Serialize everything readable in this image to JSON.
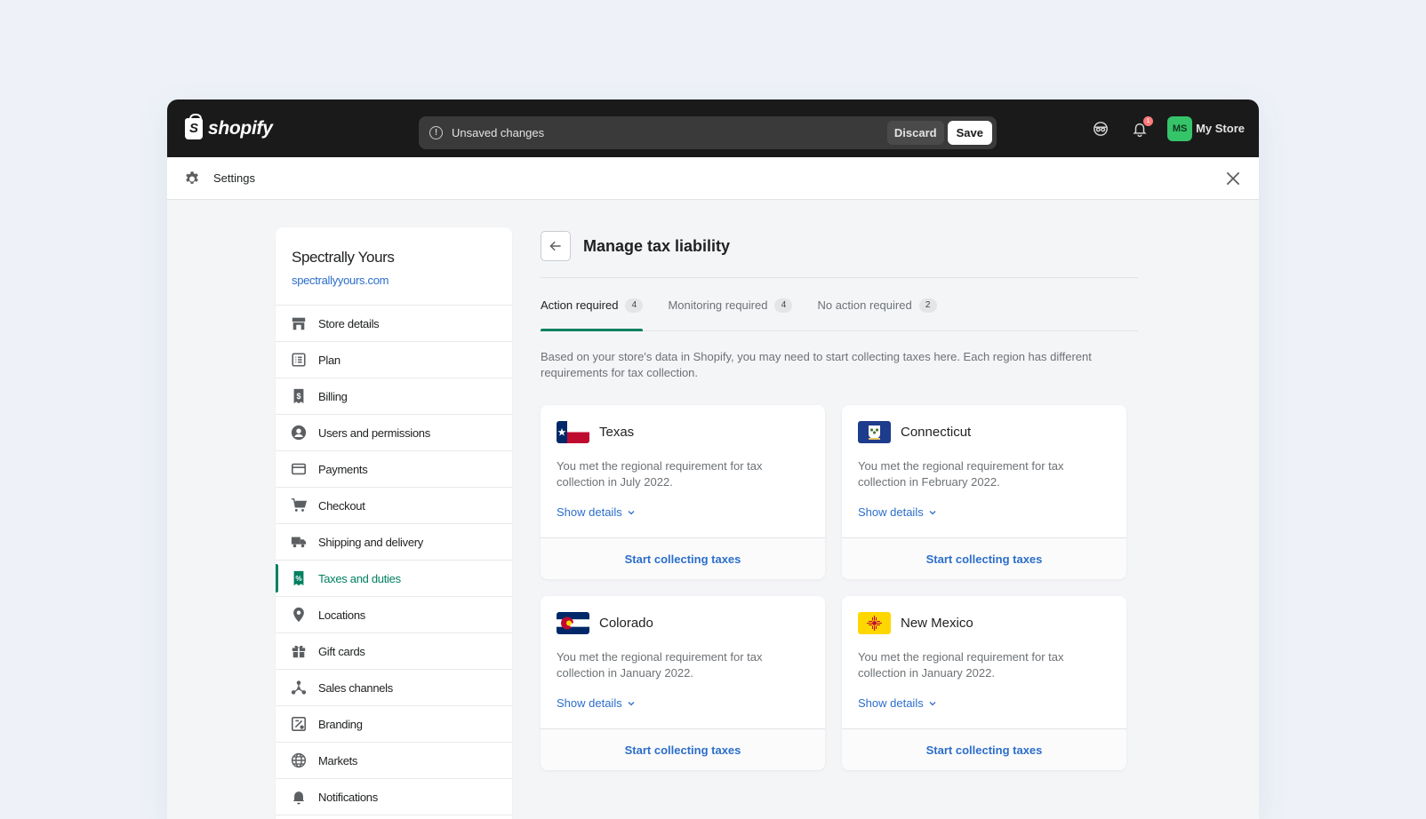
{
  "topbar": {
    "logo_text": "shopify",
    "unsaved_text": "Unsaved changes",
    "discard_label": "Discard",
    "save_label": "Save",
    "notification_count": "1",
    "avatar_initials": "MS",
    "store_name": "My Store"
  },
  "settings": {
    "title": "Settings"
  },
  "sidebar": {
    "store_title": "Spectrally Yours",
    "store_url": "spectrallyyours.com",
    "items": [
      {
        "label": "Store details",
        "icon": "store-icon"
      },
      {
        "label": "Plan",
        "icon": "plan-icon"
      },
      {
        "label": "Billing",
        "icon": "billing-icon"
      },
      {
        "label": "Users and permissions",
        "icon": "user-icon"
      },
      {
        "label": "Payments",
        "icon": "payments-icon"
      },
      {
        "label": "Checkout",
        "icon": "cart-icon"
      },
      {
        "label": "Shipping and delivery",
        "icon": "truck-icon"
      },
      {
        "label": "Taxes and duties",
        "icon": "tax-icon",
        "active": true
      },
      {
        "label": "Locations",
        "icon": "location-pin-icon"
      },
      {
        "label": "Gift cards",
        "icon": "gift-icon"
      },
      {
        "label": "Sales channels",
        "icon": "channels-icon"
      },
      {
        "label": "Branding",
        "icon": "branding-icon"
      },
      {
        "label": "Markets",
        "icon": "globe-icon"
      },
      {
        "label": "Notifications",
        "icon": "bell-icon"
      }
    ]
  },
  "main": {
    "title": "Manage tax liability",
    "tabs": [
      {
        "label": "Action required",
        "count": "4",
        "active": true
      },
      {
        "label": "Monitoring required",
        "count": "4"
      },
      {
        "label": "No action required",
        "count": "2"
      }
    ],
    "intro": "Based on your store's data in Shopify, you may need to start collecting taxes here. Each region has different requirements for tax collection.",
    "cards": [
      {
        "region": "Texas",
        "text": "You met the regional requirement for tax collection in July 2022.",
        "details_label": "Show details",
        "action_label": "Start collecting taxes"
      },
      {
        "region": "Connecticut",
        "text": "You met the regional requirement for tax collection in February 2022.",
        "details_label": "Show details",
        "action_label": "Start collecting taxes"
      },
      {
        "region": "Colorado",
        "text": "You met the regional requirement for tax collection in January 2022.",
        "details_label": "Show details",
        "action_label": "Start collecting taxes"
      },
      {
        "region": "New Mexico",
        "text": "You met the regional requirement for tax collection in January 2022.",
        "details_label": "Show details",
        "action_label": "Start collecting taxes"
      }
    ]
  },
  "colors": {
    "accent_green": "#008060",
    "link_blue": "#2c6ecb",
    "topbar_bg": "#1a1a1a"
  }
}
